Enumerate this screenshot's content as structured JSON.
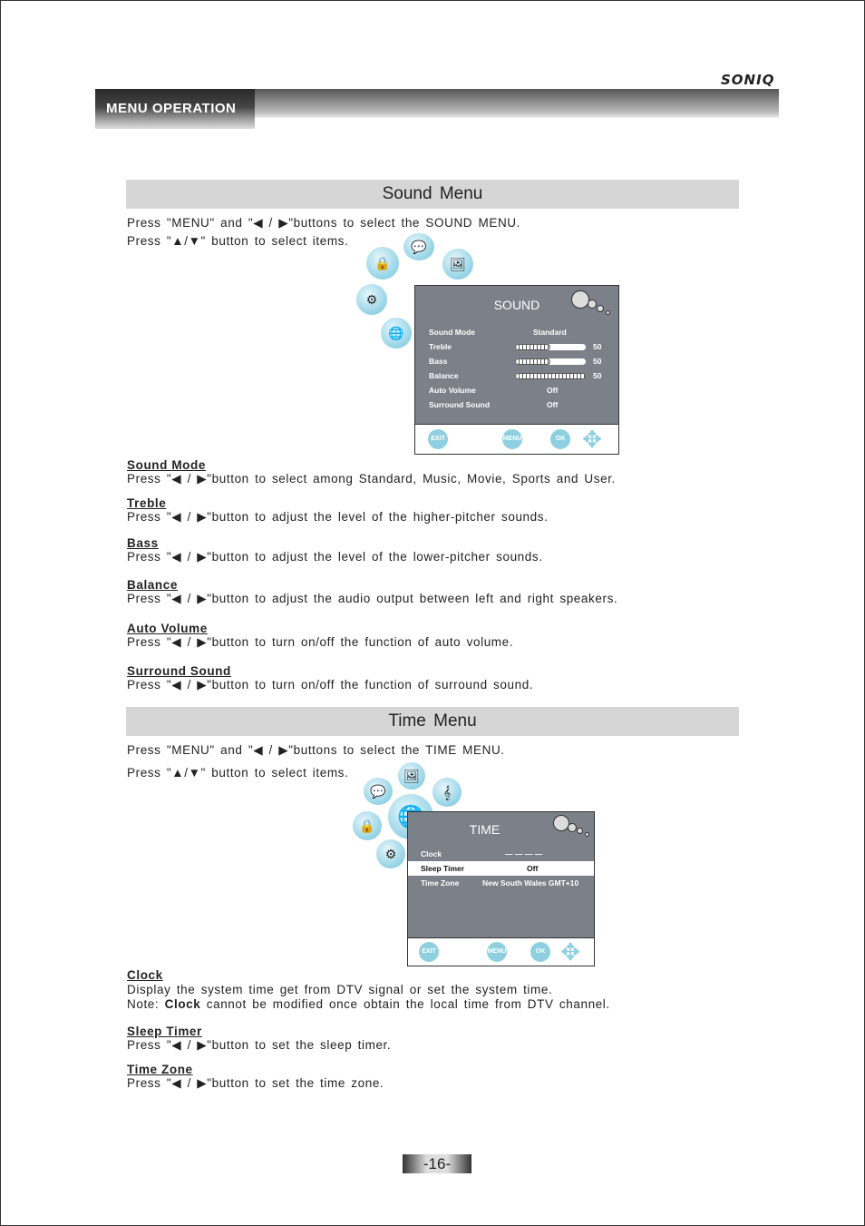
{
  "header": {
    "brand": "SONIQ",
    "section": "MENU OPERATION"
  },
  "sound": {
    "title": "Sound  Menu",
    "intro1": "Press \"MENU\" and \"◀ / ▶\"buttons to select the SOUND MENU.",
    "intro2": "Press \"▲/▼\" button to select items.",
    "osd": {
      "title": "SOUND",
      "rows": [
        {
          "label": "Sound  Mode",
          "value": "Standard"
        },
        {
          "label": "Treble",
          "value": "50",
          "level": 50
        },
        {
          "label": "Bass",
          "value": "50",
          "level": 50
        },
        {
          "label": "Balance",
          "value": "50",
          "level": 100
        },
        {
          "label": "Auto  Volume",
          "value": "Off"
        },
        {
          "label": "Surround  Sound",
          "value": "Off"
        }
      ],
      "buttons": {
        "exit": "EXIT",
        "menu": "MENU",
        "ok": "OK"
      }
    },
    "items": [
      {
        "heading": "Sound Mode",
        "text": "Press \"◀ / ▶\"button to select among Standard, Music, Movie, Sports and User."
      },
      {
        "heading": "Treble",
        "text": "Press \"◀ / ▶\"button to adjust the level of the higher-pitcher sounds."
      },
      {
        "heading": "Bass",
        "text": "Press \"◀ / ▶\"button to adjust the level of the lower-pitcher sounds."
      },
      {
        "heading": "Balance",
        "text": "Press \"◀ / ▶\"button to adjust the audio output between left and right speakers."
      },
      {
        "heading": "Auto Volume",
        "text": "Press \"◀ / ▶\"button to turn on/off the function of auto volume."
      },
      {
        "heading": "Surround Sound",
        "text": "Press \"◀ / ▶\"button to turn on/off the function of surround sound."
      }
    ]
  },
  "time": {
    "title": "Time  Menu",
    "intro1": "Press \"MENU\" and \"◀ / ▶\"buttons to select the TIME MENU.",
    "intro2": "Press \"▲/▼\" button to select items.",
    "osd": {
      "title": "TIME",
      "rows": [
        {
          "label": "Clock",
          "value": "— — — —"
        },
        {
          "label": "Sleep  Timer",
          "value": "Off"
        },
        {
          "label": "Time  Zone",
          "value": "New  South  Wales  GMT+10"
        }
      ],
      "buttons": {
        "exit": "EXIT",
        "menu": "MENU",
        "ok": "OK"
      }
    },
    "items": [
      {
        "heading": "Clock",
        "text": "Display the system time get from DTV signal or set the system time.",
        "note_prefix": "Note: ",
        "note_bold": "Clock",
        "note_rest": " cannot be modified once obtain the local time from DTV channel."
      },
      {
        "heading": "Sleep Timer",
        "text": "Press \"◀ / ▶\"button to set the sleep timer."
      },
      {
        "heading": "Time Zone",
        "text": "Press \"◀ / ▶\"button to set the time zone."
      }
    ]
  },
  "page_number": "-16-"
}
